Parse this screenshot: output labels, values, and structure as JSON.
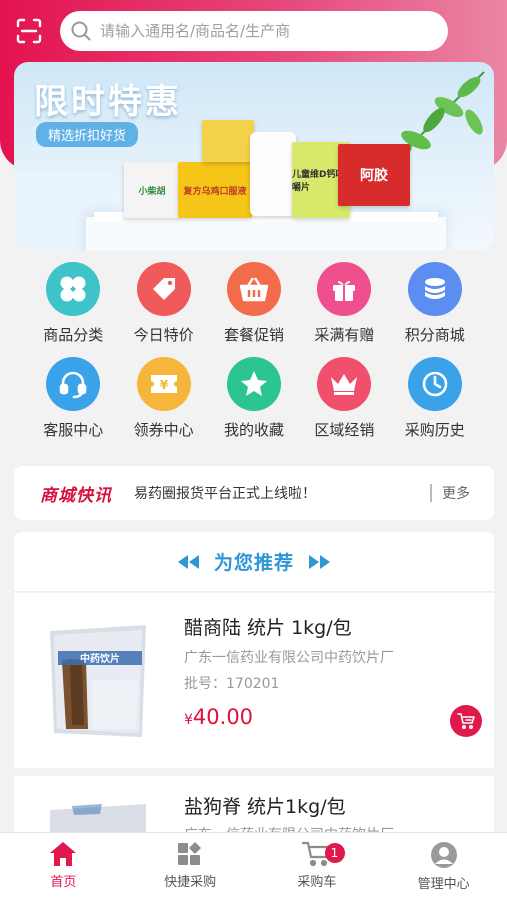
{
  "search": {
    "placeholder": "请输入通用名/商品名/生产商"
  },
  "banner": {
    "title": "限时特惠",
    "subtitle": "精选折扣好货",
    "products": [
      "小柴胡",
      "复方乌鸡口服液",
      "儿童维D钙咀嚼片",
      "阿胶"
    ]
  },
  "menu": {
    "row1": [
      {
        "label": "商品分类",
        "icon": "clover-icon",
        "color": "#3ec3c8"
      },
      {
        "label": "今日特价",
        "icon": "price-tag-icon",
        "color": "#f05a5a"
      },
      {
        "label": "套餐促销",
        "icon": "basket-icon",
        "color": "#f26b4a"
      },
      {
        "label": "采满有赠",
        "icon": "gift-icon",
        "color": "#f04f8e"
      },
      {
        "label": "积分商城",
        "icon": "coins-icon",
        "color": "#5b8ef0"
      }
    ],
    "row2": [
      {
        "label": "客服中心",
        "icon": "headset-icon",
        "color": "#3aa2e8"
      },
      {
        "label": "领券中心",
        "icon": "coupon-icon",
        "color": "#f6b63b"
      },
      {
        "label": "我的收藏",
        "icon": "star-icon",
        "color": "#2cc490"
      },
      {
        "label": "区域经销",
        "icon": "crown-icon",
        "color": "#f04f6e"
      },
      {
        "label": "采购历史",
        "icon": "clock-icon",
        "color": "#3aa2e8"
      }
    ]
  },
  "news": {
    "logo": "商城快讯",
    "text": "易药圈报货平台正式上线啦！",
    "more": "更多"
  },
  "recommend": {
    "title": "为您推荐"
  },
  "products": [
    {
      "name": "醋商陆 统片 1kg/包",
      "manufacturer": "广东一信药业有限公司中药饮片厂",
      "batch": "批号：170201",
      "currency": "¥",
      "price": "40.00",
      "package_text": "中药饮片"
    },
    {
      "name": "盐狗脊 统片1kg/包",
      "manufacturer": "广东一信药业有限公司中药饮片厂"
    }
  ],
  "tabbar": {
    "tabs": [
      {
        "label": "首页",
        "icon": "home-icon",
        "active": true
      },
      {
        "label": "快捷采购",
        "icon": "grid-icon"
      },
      {
        "label": "采购车",
        "icon": "cart-icon",
        "badge": "1"
      },
      {
        "label": "管理中心",
        "icon": "user-icon"
      }
    ]
  },
  "colors": {
    "brand": "#e0184b",
    "recommend": "#2f96d6"
  }
}
